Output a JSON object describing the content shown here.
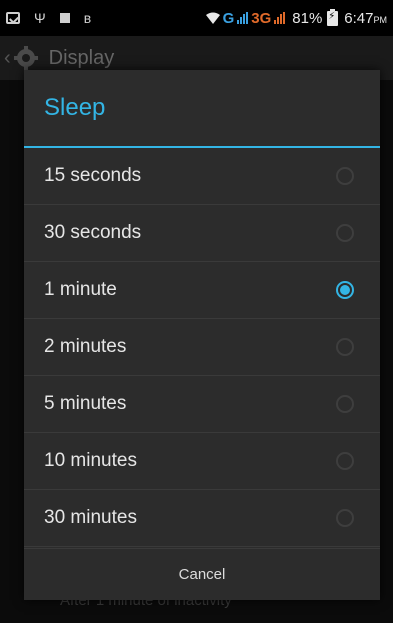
{
  "status_bar": {
    "network_g": "G",
    "network_3g": "3G",
    "battery_percent": "81%",
    "time": "6:47",
    "ampm": "PM"
  },
  "background": {
    "title": "Display",
    "summary": "After 1 minute of inactivity"
  },
  "dialog": {
    "title": "Sleep",
    "options": [
      {
        "label": "15 seconds",
        "selected": false
      },
      {
        "label": "30 seconds",
        "selected": false
      },
      {
        "label": "1 minute",
        "selected": true
      },
      {
        "label": "2 minutes",
        "selected": false
      },
      {
        "label": "5 minutes",
        "selected": false
      },
      {
        "label": "10 minutes",
        "selected": false
      },
      {
        "label": "30 minutes",
        "selected": false
      }
    ],
    "cancel_label": "Cancel"
  },
  "colors": {
    "accent": "#33b5e5",
    "dialog_bg": "#2c2c2c",
    "network_g": "#3aa0e0",
    "network_3g": "#e06a2a"
  },
  "icons": {
    "status_left": [
      "message-icon",
      "usb-icon",
      "stop-icon",
      "bluetooth-icon"
    ],
    "status_right": [
      "wifi-icon",
      "signal-icon",
      "battery-charging-icon"
    ],
    "header": [
      "back-arrow-icon",
      "settings-icon"
    ]
  }
}
